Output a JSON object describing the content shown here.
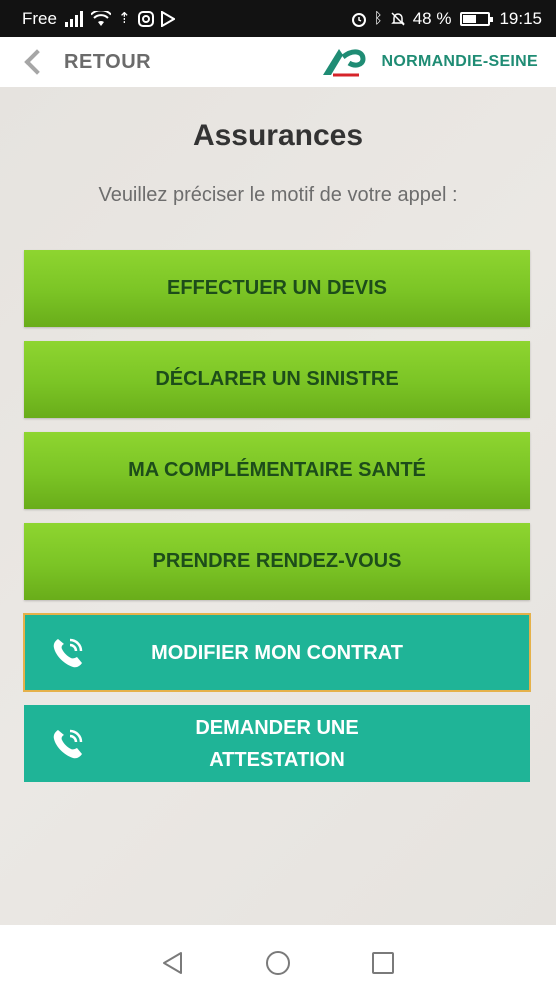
{
  "status_bar": {
    "carrier": "Free",
    "battery_percent": "48 %",
    "battery_level": 0.48,
    "time": "19:15"
  },
  "header": {
    "back_label": "RETOUR",
    "brand_name": "NORMANDIE-SEINE",
    "logo_icon": "credit-agricole-logo"
  },
  "main": {
    "title": "Assurances",
    "subtitle": "Veuillez préciser le motif de votre appel :",
    "buttons": [
      {
        "label": "EFFECTUER UN DEVIS",
        "style": "green"
      },
      {
        "label": "DÉCLARER UN SINISTRE",
        "style": "green"
      },
      {
        "label": "MA COMPLÉMENTAIRE SANTÉ",
        "style": "green"
      },
      {
        "label": "PRENDRE RENDEZ-VOUS",
        "style": "green"
      },
      {
        "label": "MODIFIER MON CONTRAT",
        "style": "teal",
        "icon": "phone-icon"
      },
      {
        "label_line1": "DEMANDER UNE",
        "label_line2": "ATTESTATION",
        "style": "teal",
        "icon": "phone-icon"
      }
    ]
  },
  "colors": {
    "green_button": "#7bc425",
    "green_text": "#1d4d1a",
    "teal_button": "#1fb497",
    "brand_teal": "#1f8c74",
    "selected_outline": "#e5b14a"
  },
  "nav": {
    "back_icon": "triangle-back-icon",
    "home_icon": "circle-home-icon",
    "recents_icon": "square-recents-icon"
  }
}
